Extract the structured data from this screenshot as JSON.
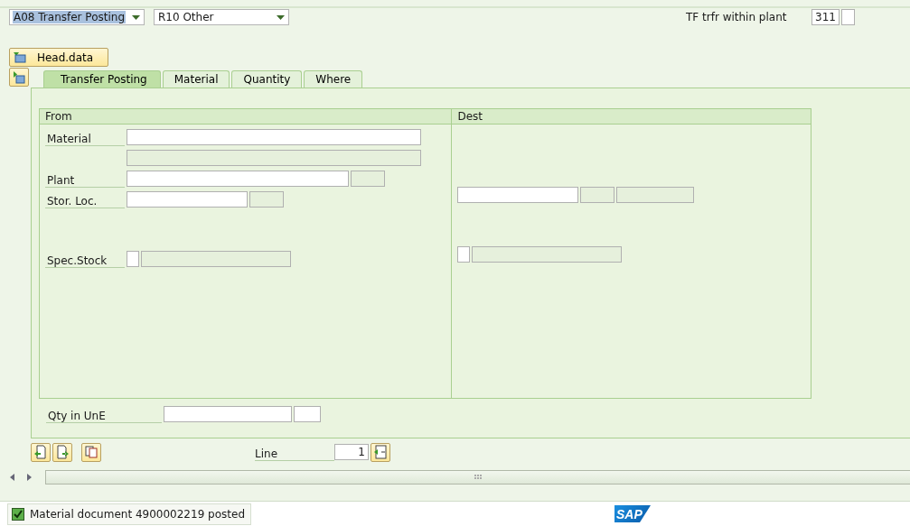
{
  "selectors": [
    {
      "value": "A08 Transfer Posting",
      "highlighted": true
    },
    {
      "value": "R10 Other",
      "highlighted": false
    }
  ],
  "movement_type": {
    "label": "TF trfr within plant",
    "value": "311"
  },
  "head_data_button": "Head.data",
  "tabs": [
    {
      "label": "Transfer Posting",
      "selected": true
    },
    {
      "label": "Material",
      "selected": false
    },
    {
      "label": "Quantity",
      "selected": false
    },
    {
      "label": "Where",
      "selected": false
    }
  ],
  "from": {
    "title": "From",
    "rows": [
      {
        "label": "Material",
        "fields": [
          {
            "disabled": false
          }
        ]
      },
      {
        "fields": [
          {
            "disabled": true
          }
        ]
      },
      {
        "label": "Plant",
        "fields": [
          {
            "disabled": false
          },
          {
            "disabled": true
          }
        ]
      },
      {
        "label": "Stor. Loc.",
        "fields": [
          {
            "disabled": false
          },
          {
            "disabled": true
          }
        ]
      },
      {
        "label": "Spec.Stock",
        "fields": [
          {
            "disabled": false
          },
          {
            "disabled": true
          }
        ]
      }
    ]
  },
  "dest": {
    "title": "Dest",
    "rows": [
      {
        "fields": [
          {
            "disabled": false
          },
          {
            "disabled": true
          },
          {
            "disabled": true
          }
        ]
      },
      {
        "fields": [
          {
            "disabled": false
          },
          {
            "disabled": true
          }
        ]
      }
    ]
  },
  "quantity": {
    "label": "Qty in UnE",
    "fields": [
      {
        "disabled": false
      },
      {
        "disabled": false
      }
    ]
  },
  "line": {
    "label": "Line",
    "value": "1"
  },
  "status_message": "Material document 4900002219 posted",
  "logo": "SAP"
}
